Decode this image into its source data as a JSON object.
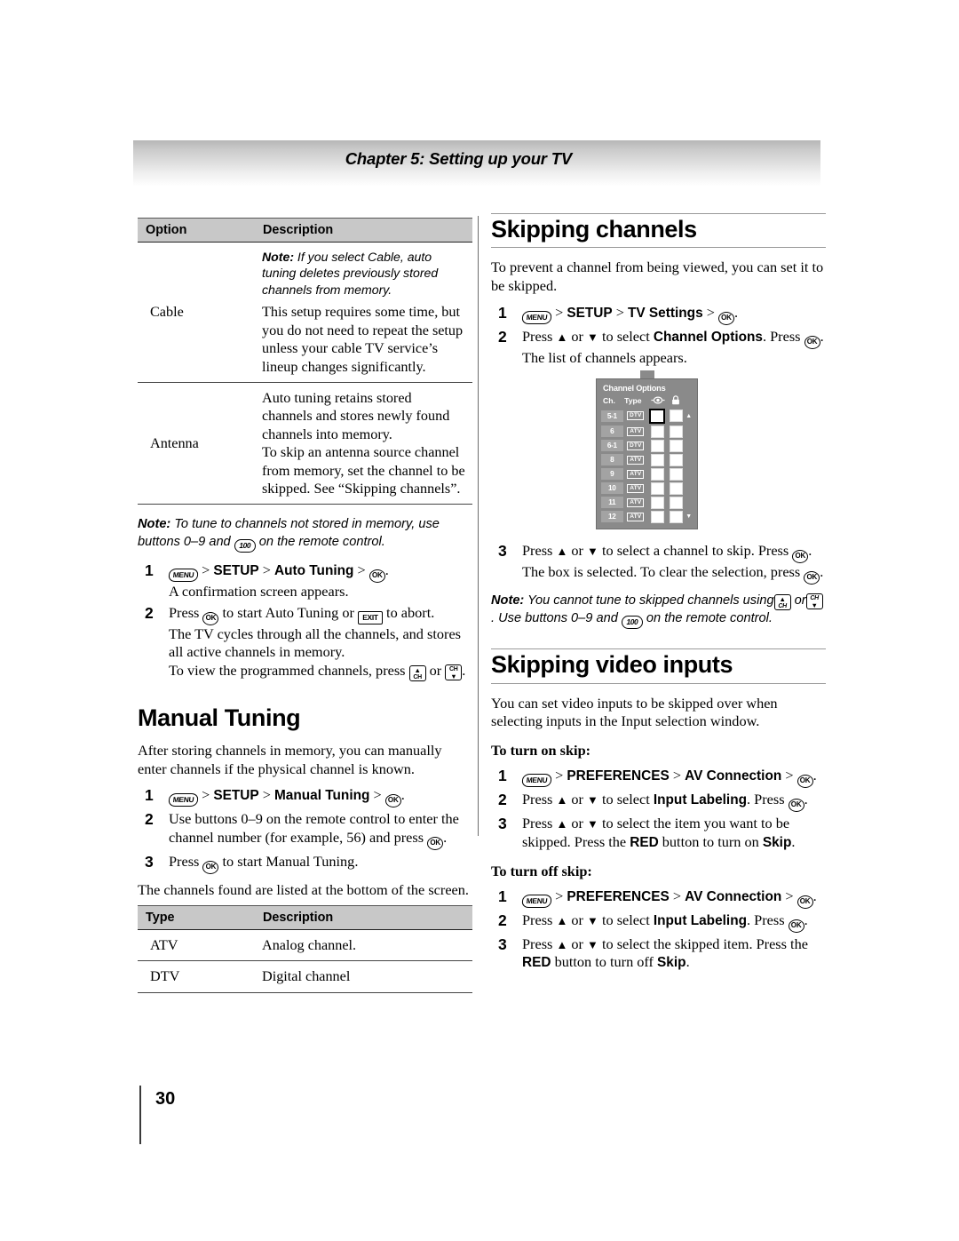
{
  "header": {
    "chapter_title": "Chapter 5: Setting up your TV"
  },
  "footer": {
    "page_number": "30"
  },
  "left_column": {
    "options_table": {
      "headers": [
        "Option",
        "Description"
      ],
      "rows": [
        {
          "option": "Cable",
          "note_label": "Note:",
          "note_text": " If you select Cable, auto tuning deletes previously stored channels from memory.",
          "body": "This setup requires some time, but you do not need to repeat the setup unless your cable TV service’s lineup changes significantly."
        },
        {
          "option": "Antenna",
          "note_label": "",
          "note_text": "",
          "body": "Auto tuning retains stored channels and stores newly found channels into memory.\nTo skip an antenna source channel from memory, set the channel to be skipped. See “Skipping channels”."
        }
      ]
    },
    "note_tune": {
      "label": "Note:",
      "part1": " To tune to channels not stored in memory, use buttons 0–9 and",
      "part2": " on the remote control."
    },
    "auto_tuning_steps": [
      {
        "num": "1",
        "main_menu": "MENU",
        "main_text_1": " > ",
        "bold_1": "SETUP",
        "main_text_2": " > ",
        "bold_2": "Auto Tuning",
        "main_text_3": " > ",
        "ok": "OK",
        "tail": ".",
        "sub": "A confirmation screen appears."
      },
      {
        "num": "2",
        "pre": "Press ",
        "ok": "OK",
        "mid": " to start Auto Tuning or ",
        "exit": "EXIT",
        "post": " to abort.",
        "sub_1": "The TV cycles through all the channels, and stores all active channels in memory.",
        "sub_2a": "To view the programmed channels, press ",
        "sub_2b": " or ",
        "sub_2c": "."
      }
    ],
    "manual_tuning": {
      "heading": "Manual Tuning",
      "intro": "After storing channels in memory, you can manually enter channels if the physical channel is known.",
      "steps": [
        {
          "num": "1",
          "menu": "MENU",
          "sep1": " > ",
          "bold1": "SETUP",
          "sep2": " > ",
          "bold2": "Manual Tuning",
          "sep3": " > ",
          "ok": "OK",
          "tail": "."
        },
        {
          "num": "2",
          "text_a": "Use buttons 0–9 on the remote control to enter the channel number (for example, 56) and press ",
          "ok": "OK",
          "tail": "."
        },
        {
          "num": "3",
          "text_a": "Press ",
          "ok": "OK",
          "tail": " to start Manual Tuning."
        }
      ],
      "after_steps": "The channels found are listed at the bottom of the screen."
    },
    "type_table": {
      "headers": [
        "Type",
        "Description"
      ],
      "rows": [
        {
          "type": "ATV",
          "description": "Analog channel."
        },
        {
          "type": "DTV",
          "description": "Digital channel"
        }
      ]
    }
  },
  "right_column": {
    "skipping_channels": {
      "heading": "Skipping channels",
      "intro": "To prevent a channel from being viewed, you can set it to be skipped.",
      "steps": [
        {
          "num": "1",
          "menu": "MENU",
          "sep1": " > ",
          "bold1": "SETUP",
          "sep2": " > ",
          "bold2": "TV Settings",
          "sep3": " > ",
          "ok": "OK",
          "tail": "."
        },
        {
          "num": "2",
          "pre": "Press ",
          "up": "▲",
          "mid1": " or ",
          "down": "▼",
          "mid2": " to select ",
          "bold": "Channel Options",
          "mid3": ". Press ",
          "ok": "OK",
          "tail": ".",
          "sub": "The list of channels appears."
        }
      ],
      "step3": {
        "num": "3",
        "pre": "Press ",
        "up": "▲",
        "mid1": " or ",
        "down": "▼",
        "mid2": " to select a channel to skip. Press ",
        "ok": "OK",
        "tail": ".",
        "sub_a": "The box is selected. To clear the selection, press ",
        "sub_ok": "OK",
        "sub_tail": "."
      },
      "note": {
        "label": "Note:",
        "part1": " You cannot tune to skipped channels using",
        "part2": " or",
        "part3": ".",
        "part4": "Use buttons 0–9 and",
        "part5": " on the remote control."
      }
    },
    "channel_options_graphic": {
      "title": "Channel Options",
      "column_headers": [
        "Ch.",
        "Type",
        "skip-eye-icon",
        "lock-icon"
      ],
      "rows": [
        {
          "ch": "5-1",
          "type": "DTV",
          "skip_selected": true,
          "lock_selected": false
        },
        {
          "ch": "6",
          "type": "ATV",
          "skip_selected": false,
          "lock_selected": false
        },
        {
          "ch": "6-1",
          "type": "DTV",
          "skip_selected": false,
          "lock_selected": false
        },
        {
          "ch": "8",
          "type": "ATV",
          "skip_selected": false,
          "lock_selected": false
        },
        {
          "ch": "9",
          "type": "ATV",
          "skip_selected": false,
          "lock_selected": false
        },
        {
          "ch": "10",
          "type": "ATV",
          "skip_selected": false,
          "lock_selected": false
        },
        {
          "ch": "11",
          "type": "ATV",
          "skip_selected": false,
          "lock_selected": false
        },
        {
          "ch": "12",
          "type": "ATV",
          "skip_selected": false,
          "lock_selected": false
        }
      ],
      "scroll_up": "▲",
      "scroll_down": "▼"
    },
    "skipping_video_inputs": {
      "heading": "Skipping video inputs",
      "intro": "You can set video inputs to be skipped over when selecting inputs in the Input selection window.",
      "turn_on_label": "To turn on skip:",
      "turn_on_steps": [
        {
          "num": "1",
          "menu": "MENU",
          "sep1": " > ",
          "bold1": "PREFERENCES",
          "sep2": " > ",
          "bold2": "AV Connection",
          "sep3": " > ",
          "ok": "OK",
          "tail": "."
        },
        {
          "num": "2",
          "pre": "Press ",
          "up": "▲",
          "mid1": " or ",
          "down": "▼",
          "mid2": " to select ",
          "bold": "Input Labeling",
          "mid3": ". Press ",
          "ok": "OK",
          "tail": "."
        },
        {
          "num": "3",
          "pre": "Press ",
          "up": "▲",
          "mid1": " or ",
          "down": "▼",
          "mid2": " to select the item you want to be skipped. Press the ",
          "red": "RED",
          "mid3": " button to turn on ",
          "skip": "Skip",
          "tail": "."
        }
      ],
      "turn_off_label": "To turn off skip:",
      "turn_off_steps": [
        {
          "num": "1",
          "menu": "MENU",
          "sep1": " > ",
          "bold1": "PREFERENCES",
          "sep2": " > ",
          "bold2": "AV Connection",
          "sep3": " > ",
          "ok": "OK",
          "tail": "."
        },
        {
          "num": "2",
          "pre": "Press ",
          "up": "▲",
          "mid1": " or ",
          "down": "▼",
          "mid2": " to select ",
          "bold": "Input Labeling",
          "mid3": ". Press ",
          "ok": "OK",
          "tail": "."
        },
        {
          "num": "3",
          "pre": "Press ",
          "up": "▲",
          "mid1": " or ",
          "down": "▼",
          "mid2": " to select the skipped item. Press the ",
          "red": "RED",
          "mid3": " button to turn off ",
          "skip": "Skip",
          "tail": "."
        }
      ]
    }
  },
  "icons": {
    "menu": "MENU",
    "ok": "OK",
    "exit": "EXIT",
    "hundred": "100",
    "ch_label": "CH",
    "up_arrow": "▲",
    "down_arrow": "▼"
  },
  "colors": {
    "table_header_bg": "#c8c8c8",
    "rule": "#9a9a9a",
    "osd_bg": "#8a8a8a",
    "osd_row": "#a3a3a3"
  }
}
